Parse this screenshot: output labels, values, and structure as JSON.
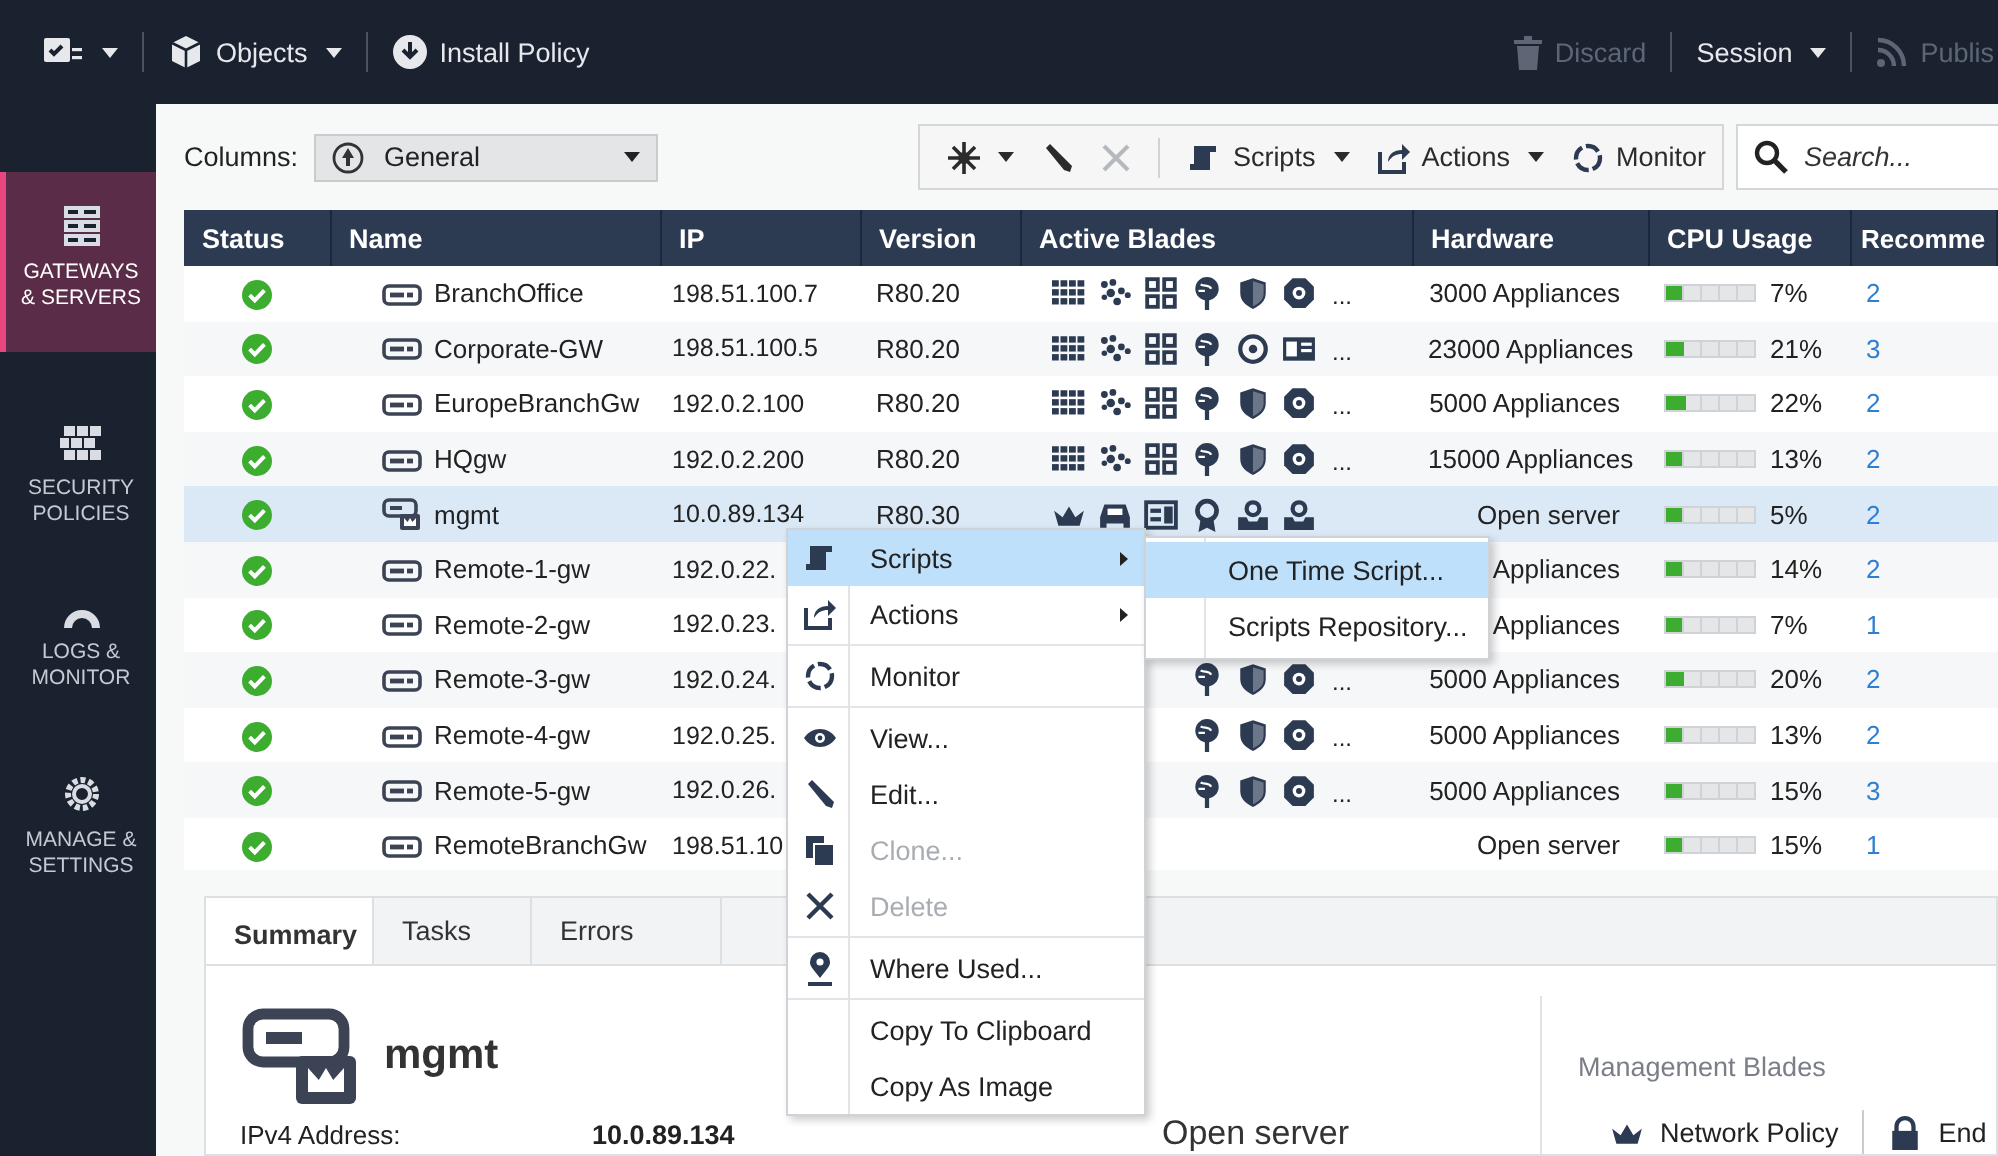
{
  "top_bar": {
    "objects": "Objects",
    "install": "Install Policy",
    "discard": {
      "label": "Discard",
      "disabled": true
    },
    "session": {
      "label": "Session",
      "disabled": false
    },
    "publish": {
      "label": "Publis",
      "disabled": true
    }
  },
  "sidebar": {
    "items": [
      {
        "lines": [
          "GATEWAYS",
          "& SERVERS"
        ],
        "selected": true
      },
      {
        "lines": [
          "SECURITY",
          "POLICIES"
        ],
        "selected": false
      },
      {
        "lines": [
          "LOGS &",
          "MONITOR"
        ],
        "selected": false
      },
      {
        "lines": [
          "MANAGE &",
          "SETTINGS"
        ],
        "selected": false
      }
    ]
  },
  "toolbar": {
    "columns_label": "Columns:",
    "view": "General",
    "search_placeholder": "Search...",
    "tools": [
      {
        "kind": "new",
        "disabled": false
      },
      {
        "kind": "edit",
        "disabled": false
      },
      {
        "kind": "delete",
        "disabled": true
      },
      {
        "kind": "scripts",
        "label": "Scripts",
        "disabled": false
      },
      {
        "kind": "actions",
        "label": "Actions",
        "disabled": false
      },
      {
        "kind": "monitor",
        "label": "Monitor",
        "disabled": false
      }
    ]
  },
  "table": {
    "columns": [
      "Status",
      "Name",
      "IP",
      "Version",
      "Active Blades",
      "Hardware",
      "CPU Usage",
      "Recomme"
    ],
    "rows": [
      {
        "status": {
          "kind": "ok"
        },
        "node": {
          "kind": "gateway"
        },
        "name": "BranchOffice",
        "ip": "198.51.100.7",
        "version": "R80.20",
        "blades": [
          {
            "kind": "grid"
          },
          {
            "kind": "dots"
          },
          {
            "kind": "tiles"
          },
          {
            "kind": "globe"
          },
          {
            "kind": "shield"
          },
          {
            "kind": "gear"
          }
        ],
        "more": "...",
        "hardware": "3000 Appliances",
        "cpu": "7%",
        "level": 0.07,
        "recommendations": "2",
        "selected": false
      },
      {
        "status": {
          "kind": "ok"
        },
        "node": {
          "kind": "gateway"
        },
        "name": "Corporate-GW",
        "ip": "198.51.100.5",
        "version": "R80.20",
        "blades": [
          {
            "kind": "grid"
          },
          {
            "kind": "dots"
          },
          {
            "kind": "tiles"
          },
          {
            "kind": "globe"
          },
          {
            "kind": "target"
          },
          {
            "kind": "card"
          }
        ],
        "more": "...",
        "hardware": "23000 Appliances",
        "cpu": "21%",
        "level": 0.21,
        "recommendations": "3",
        "selected": false
      },
      {
        "status": {
          "kind": "ok"
        },
        "node": {
          "kind": "gateway"
        },
        "name": "EuropeBranchGw",
        "ip": "192.0.2.100",
        "version": "R80.20",
        "blades": [
          {
            "kind": "grid"
          },
          {
            "kind": "dots"
          },
          {
            "kind": "tiles"
          },
          {
            "kind": "globe"
          },
          {
            "kind": "shield"
          },
          {
            "kind": "gear"
          }
        ],
        "more": "...",
        "hardware": "5000 Appliances",
        "cpu": "22%",
        "level": 0.22,
        "recommendations": "2",
        "selected": false
      },
      {
        "status": {
          "kind": "ok"
        },
        "node": {
          "kind": "gateway"
        },
        "name": "HQgw",
        "ip": "192.0.2.200",
        "version": "R80.20",
        "blades": [
          {
            "kind": "grid"
          },
          {
            "kind": "dots"
          },
          {
            "kind": "tiles"
          },
          {
            "kind": "globe"
          },
          {
            "kind": "shield"
          },
          {
            "kind": "gear"
          }
        ],
        "more": "...",
        "hardware": "15000 Appliances",
        "cpu": "13%",
        "level": 0.13,
        "recommendations": "2",
        "selected": false
      },
      {
        "status": {
          "kind": "ok"
        },
        "node": {
          "kind": "management"
        },
        "name": "mgmt",
        "ip": "10.0.89.134",
        "version": "R80.30",
        "blades": [
          {
            "kind": "crown"
          },
          {
            "kind": "car"
          },
          {
            "kind": "panel"
          },
          {
            "kind": "ribbon"
          },
          {
            "kind": "tray"
          },
          {
            "kind": "tray"
          }
        ],
        "hardware": "Open server",
        "cpu": "5%",
        "level": 0.05,
        "recommendations": "2",
        "selected": true
      },
      {
        "status": {
          "kind": "ok"
        },
        "node": {
          "kind": "gateway"
        },
        "name": "Remote-1-gw",
        "ip": "192.0.22.",
        "hardware": "Appliances",
        "cpu": "14%",
        "level": 0.14,
        "recommendations": "2",
        "selected": false
      },
      {
        "status": {
          "kind": "ok"
        },
        "node": {
          "kind": "gateway"
        },
        "name": "Remote-2-gw",
        "ip": "192.0.23.",
        "hardware": "Appliances",
        "cpu": "7%",
        "level": 0.07,
        "recommendations": "1",
        "selected": false
      },
      {
        "status": {
          "kind": "ok"
        },
        "node": {
          "kind": "gateway"
        },
        "name": "Remote-3-gw",
        "ip": "192.0.24.",
        "blades": [
          {
            "kind": "globe"
          },
          {
            "kind": "shield"
          },
          {
            "kind": "gear"
          }
        ],
        "more": "...",
        "hardware": "5000 Appliances",
        "cpu": "20%",
        "level": 0.2,
        "recommendations": "2",
        "selected": false
      },
      {
        "status": {
          "kind": "ok"
        },
        "node": {
          "kind": "gateway"
        },
        "name": "Remote-4-gw",
        "ip": "192.0.25.",
        "blades": [
          {
            "kind": "globe"
          },
          {
            "kind": "shield"
          },
          {
            "kind": "gear"
          }
        ],
        "more": "...",
        "hardware": "5000 Appliances",
        "cpu": "13%",
        "level": 0.13,
        "recommendations": "2",
        "selected": false
      },
      {
        "status": {
          "kind": "ok"
        },
        "node": {
          "kind": "gateway"
        },
        "name": "Remote-5-gw",
        "ip": "192.0.26.",
        "blades": [
          {
            "kind": "globe"
          },
          {
            "kind": "shield"
          },
          {
            "kind": "gear"
          }
        ],
        "more": "...",
        "hardware": "5000 Appliances",
        "cpu": "15%",
        "level": 0.15,
        "recommendations": "3",
        "selected": false
      },
      {
        "status": {
          "kind": "ok"
        },
        "node": {
          "kind": "gateway"
        },
        "name": "RemoteBranchGw",
        "ip": "198.51.10",
        "hardware": "Open server",
        "cpu": "15%",
        "level": 0.15,
        "recommendations": "1",
        "selected": false
      }
    ]
  },
  "context_menu": {
    "groups": [
      [
        {
          "kind": "scripts",
          "label": "Scripts",
          "submenu": true,
          "selected": true,
          "disabled": false
        },
        {
          "kind": "actions",
          "label": "Actions",
          "submenu": true,
          "selected": false,
          "disabled": false
        }
      ],
      [
        {
          "kind": "monitor",
          "label": "Monitor",
          "submenu": false,
          "selected": false,
          "disabled": false
        }
      ],
      [
        {
          "kind": "view",
          "label": "View...",
          "submenu": false,
          "selected": false,
          "disabled": false
        },
        {
          "kind": "edit",
          "label": "Edit...",
          "submenu": false,
          "selected": false,
          "disabled": false
        },
        {
          "kind": "clone",
          "label": "Clone...",
          "submenu": false,
          "selected": false,
          "disabled": true
        },
        {
          "kind": "delete",
          "label": "Delete",
          "submenu": false,
          "selected": false,
          "disabled": true
        }
      ],
      [
        {
          "kind": "where",
          "label": "Where Used...",
          "submenu": false,
          "selected": false,
          "disabled": false
        }
      ],
      [
        {
          "kind": "plain",
          "label": "Copy To Clipboard",
          "submenu": false,
          "selected": false,
          "disabled": false
        },
        {
          "kind": "plain",
          "label": "Copy As Image",
          "submenu": false,
          "selected": false,
          "disabled": false
        }
      ]
    ]
  },
  "submenu": {
    "items": [
      {
        "label": "One Time Script...",
        "selected": true
      },
      {
        "label": "Scripts Repository...",
        "selected": false
      }
    ]
  },
  "details": {
    "tabs": [
      {
        "label": "Summary",
        "selected": true
      },
      {
        "label": "Tasks",
        "selected": false
      },
      {
        "label": "Errors",
        "selected": false
      }
    ],
    "name": "mgmt",
    "node": {
      "kind": "management"
    },
    "ipv4_label": "IPv4 Address:",
    "ipv4": "10.0.89.134",
    "hardware": "Open server",
    "blades_title": "Management Blades",
    "blades": [
      {
        "kind": "crown",
        "label": "Network Policy"
      },
      {
        "kind": "lock",
        "label": "End"
      }
    ]
  }
}
